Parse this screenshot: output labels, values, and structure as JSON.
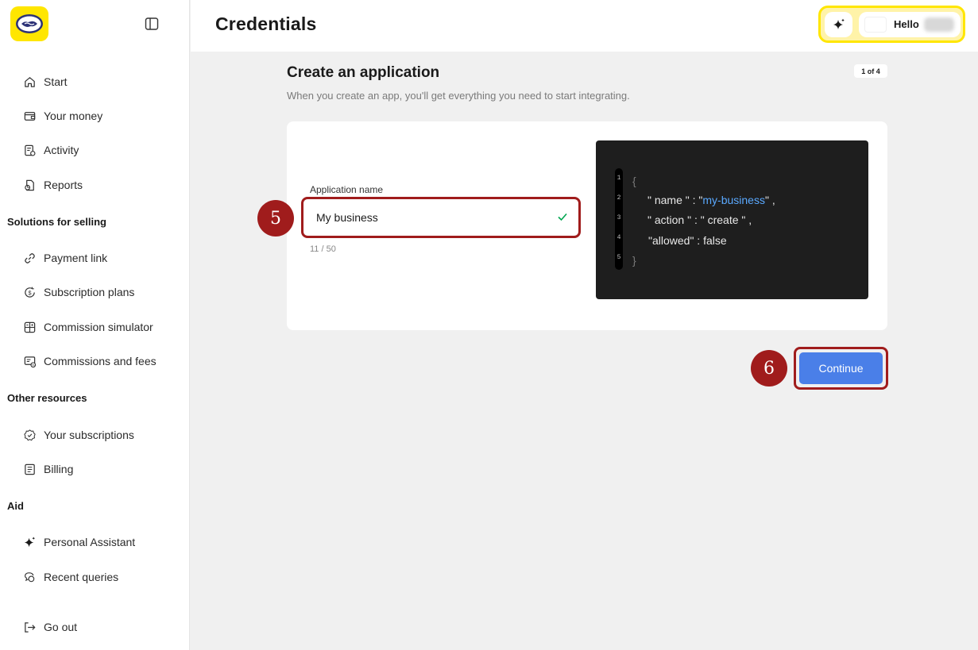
{
  "app": {
    "title": "Credentials"
  },
  "sidebar": {
    "items_main": [
      {
        "label": "Start",
        "icon": "home-icon"
      },
      {
        "label": "Your money",
        "icon": "wallet-icon"
      },
      {
        "label": "Activity",
        "icon": "activity-icon"
      },
      {
        "label": "Reports",
        "icon": "reports-icon"
      }
    ],
    "section_selling": "Solutions for selling",
    "items_selling": [
      {
        "label": "Payment link",
        "icon": "link-icon"
      },
      {
        "label": "Subscription plans",
        "icon": "subscription-icon"
      },
      {
        "label": "Commission simulator",
        "icon": "calculator-icon"
      },
      {
        "label": "Commissions and fees",
        "icon": "fees-icon"
      }
    ],
    "section_other": "Other resources",
    "items_other": [
      {
        "label": "Your subscriptions",
        "icon": "badge-icon"
      },
      {
        "label": "Billing",
        "icon": "billing-icon"
      }
    ],
    "section_aid": "Aid",
    "items_aid": [
      {
        "label": "Personal Assistant",
        "icon": "sparkle-icon"
      },
      {
        "label": "Recent queries",
        "icon": "queries-icon"
      }
    ],
    "logout": {
      "label": "Go out",
      "icon": "logout-icon"
    }
  },
  "header": {
    "greeting": "Hello"
  },
  "step": {
    "title": "Create an application",
    "subtitle": "When you create an app, you'll get everything you need to start integrating.",
    "badge": "1 of 4"
  },
  "form": {
    "label": "Application name",
    "value": "My business",
    "counter": "11 / 50"
  },
  "code": {
    "line_numbers": [
      "1",
      "2",
      "3",
      "4",
      "5"
    ],
    "open_brace": "{",
    "line2_key": "\" name \" : \"",
    "line2_value": "my-business",
    "line2_end": "\" ,",
    "line3": "\" action \" : \" create \" ,",
    "line4": "\"allowed\" : false",
    "close_brace": "}"
  },
  "markers": {
    "field": "5",
    "button": "6"
  },
  "actions": {
    "continue": "Continue"
  },
  "colors": {
    "brand_yellow": "#ffe600",
    "accent_blue": "#4a7fe8",
    "marker_red": "#a01c1c",
    "code_bg": "#1e1e1e",
    "code_string": "#5aa9ff"
  }
}
